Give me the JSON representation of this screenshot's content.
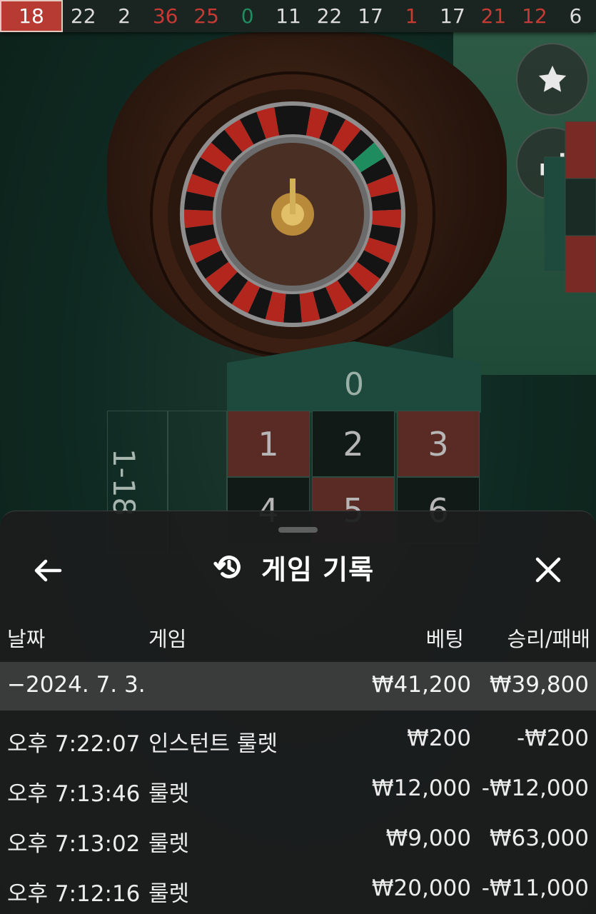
{
  "results": [
    {
      "n": "18",
      "c": "red"
    },
    {
      "n": "22",
      "c": "black"
    },
    {
      "n": "2",
      "c": "black"
    },
    {
      "n": "36",
      "c": "red"
    },
    {
      "n": "25",
      "c": "red"
    },
    {
      "n": "0",
      "c": "green"
    },
    {
      "n": "11",
      "c": "black"
    },
    {
      "n": "22",
      "c": "black"
    },
    {
      "n": "17",
      "c": "black"
    },
    {
      "n": "1",
      "c": "red"
    },
    {
      "n": "17",
      "c": "black"
    },
    {
      "n": "21",
      "c": "red"
    },
    {
      "n": "12",
      "c": "red"
    },
    {
      "n": "6",
      "c": "black"
    }
  ],
  "colors": {
    "red": "#c63a33",
    "black": "#dcdcdc",
    "green": "#1f8c60"
  },
  "table": {
    "zero": "0",
    "cells": [
      {
        "n": "1",
        "c": "r"
      },
      {
        "n": "2",
        "c": "b"
      },
      {
        "n": "3",
        "c": "r"
      },
      {
        "n": "4",
        "c": "b"
      },
      {
        "n": "5",
        "c": "r"
      },
      {
        "n": "6",
        "c": "b"
      }
    ],
    "side_label": "1-18"
  },
  "sheet": {
    "title": "게임 기록",
    "icons": {
      "back": "arrow-left-icon",
      "history": "history-icon",
      "close": "close-icon",
      "favorite": "star-icon",
      "stats": "statistics-icon"
    },
    "columns": {
      "date": "날짜",
      "game": "게임",
      "bet": "베팅",
      "result": "승리/패배"
    },
    "day": {
      "date": "−2024. 7. 3.",
      "bet": "₩41,200",
      "result": "₩39,800"
    },
    "rows": [
      {
        "time": "오후 7:22:07",
        "game": "인스턴트 룰렛",
        "bet": "₩200",
        "result": "-₩200"
      },
      {
        "time": "오후 7:13:46",
        "game": "룰렛",
        "bet": "₩12,000",
        "result": "-₩12,000"
      },
      {
        "time": "오후 7:13:02",
        "game": "룰렛",
        "bet": "₩9,000",
        "result": "₩63,000"
      },
      {
        "time": "오후 7:12:16",
        "game": "룰렛",
        "bet": "₩20,000",
        "result": "-₩11,000"
      }
    ]
  }
}
